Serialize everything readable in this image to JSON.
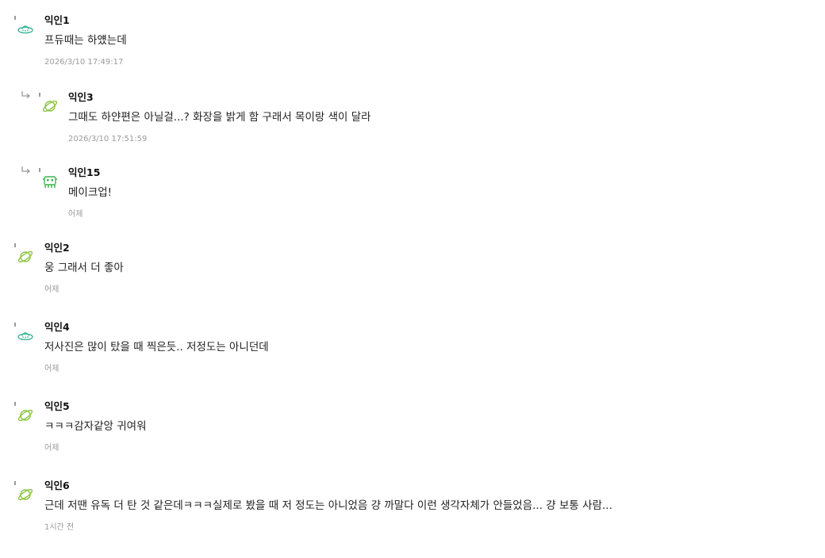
{
  "comments": [
    {
      "author": "익인1",
      "text": "프듀때는 하얬는데",
      "time": "2026/3/10 17:49:17",
      "icon": "ufo-icon",
      "reply": false
    },
    {
      "author": "익인3",
      "text": "그때도 하얀편은 아닐걸...? 화장을 밝게 함 구래서 목이랑 색이 달라",
      "time": "2026/3/10 17:51:59",
      "icon": "planet-icon",
      "reply": true
    },
    {
      "author": "익인15",
      "text": "메이크업!",
      "time": "어제",
      "icon": "alien-icon",
      "reply": true
    },
    {
      "author": "익인2",
      "text": "웅 그래서 더 좋아",
      "time": "어제",
      "icon": "planet-icon",
      "reply": false
    },
    {
      "author": "익인4",
      "text": "저사진은 많이 탔을 때 찍은듯.. 저정도는 아니던데",
      "time": "어제",
      "icon": "ufo-icon",
      "reply": false
    },
    {
      "author": "익인5",
      "text": "ㅋㅋㅋ감자같앙 귀여워",
      "time": "어제",
      "icon": "planet-icon",
      "reply": false
    },
    {
      "author": "익인6",
      "text": "근데 저땐 유독 더 탄 것 같은데ㅋㅋㅋ실제로 봤을 때 저 정도는 아니었음 걍 까말다 이런 생각자체가 안들었음... 걍 보통 사람...",
      "time": "1시간 전",
      "icon": "planet-icon",
      "reply": false
    }
  ],
  "colors": {
    "ufo": "#3fb59a",
    "planet": "#8cc63f",
    "alien": "#3cb54a"
  }
}
